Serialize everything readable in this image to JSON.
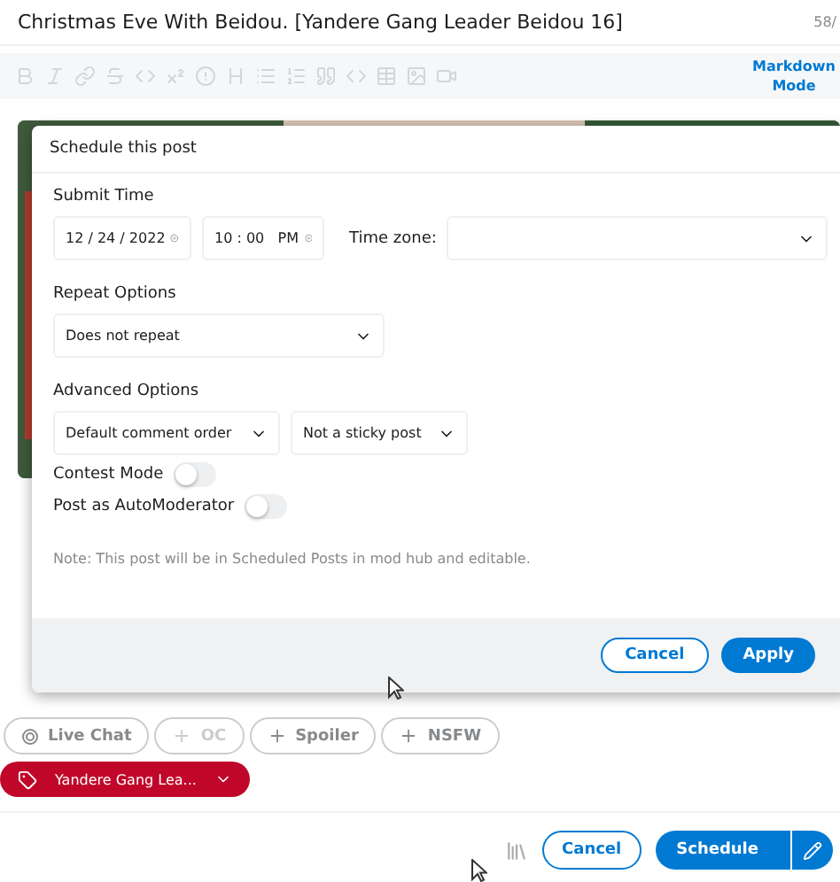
{
  "post": {
    "title": "Christmas Eve With Beidou. [Yandere Gang Leader Beidou 16]",
    "counter": "58/",
    "markdown_link": "Markdown Mode",
    "toolbar_disabled": true
  },
  "tags": [
    {
      "kind": "icon",
      "label": "Live Chat",
      "disabled": false
    },
    {
      "kind": "plus",
      "label": "OC",
      "disabled": true
    },
    {
      "kind": "plus",
      "label": "Spoiler",
      "disabled": false
    },
    {
      "kind": "plus",
      "label": "NSFW",
      "disabled": false
    }
  ],
  "flair": {
    "label": "Yandere Gang Lea...",
    "color": "#c0072a"
  },
  "footer": {
    "cancel": "Cancel",
    "schedule": "Schedule"
  },
  "modal": {
    "title": "Schedule this post",
    "submit_time": {
      "label": "Submit Time",
      "date": "12 / 24 / 2022",
      "time": "10 : 00   PM",
      "timezone_label": "Time zone:"
    },
    "repeat": {
      "label": "Repeat Options",
      "value": "Does not repeat"
    },
    "advanced": {
      "label": "Advanced Options",
      "comment_order": "Default comment order",
      "sticky": "Not a sticky post"
    },
    "toggles": [
      {
        "label": "Contest Mode",
        "on": false
      },
      {
        "label": "Post as AutoModerator",
        "on": false
      }
    ],
    "note": "Note: This post will be in Scheduled Posts in mod hub and editable.",
    "buttons": [
      {
        "kind": "secondary",
        "label": "Cancel"
      },
      {
        "kind": "primary",
        "label": "Apply"
      }
    ]
  }
}
